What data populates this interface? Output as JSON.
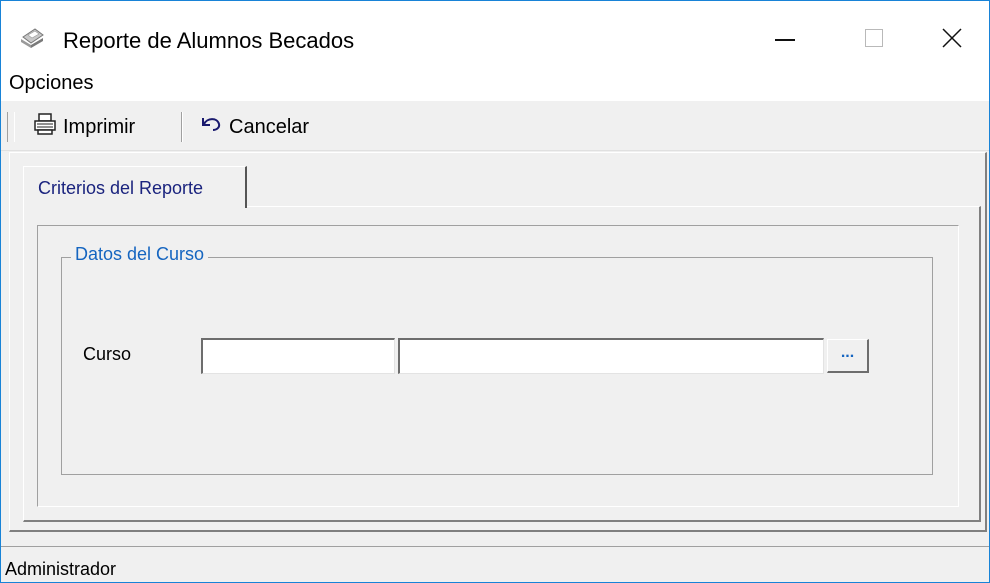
{
  "window": {
    "title": "Reporte de Alumnos Becados",
    "icon": "printer-app-icon"
  },
  "menu": {
    "items": [
      {
        "label": "Opciones"
      }
    ]
  },
  "toolbar": {
    "print_label": "Imprimir",
    "cancel_label": "Cancelar"
  },
  "tabs": [
    {
      "label": "Criterios del Reporte",
      "active": true
    }
  ],
  "group": {
    "legend": "Datos del Curso",
    "curso_label": "Curso",
    "curso_code_value": "",
    "curso_desc_value": "",
    "browse_label": "..."
  },
  "status": {
    "user": "Administrador"
  },
  "colors": {
    "accent": "#1883d7",
    "tab_text": "#1a237e",
    "legend_text": "#1565c0"
  }
}
